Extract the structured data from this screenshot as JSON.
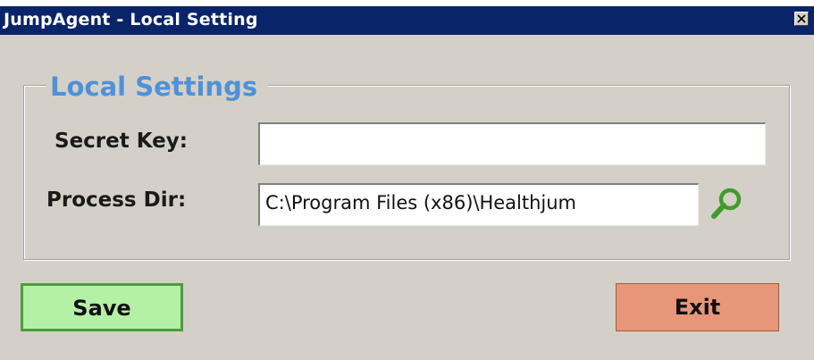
{
  "window": {
    "title": "JumpAgent - Local Setting"
  },
  "group": {
    "legend": "Local Settings"
  },
  "fields": {
    "secret_key": {
      "label": "Secret Key:",
      "value": ""
    },
    "process_dir": {
      "label": "Process Dir:",
      "value": "C:\\Program Files (x86)\\Healthjum"
    }
  },
  "buttons": {
    "save_label": "Save",
    "exit_label": "Exit"
  },
  "icons": {
    "close": "close-icon",
    "browse": "magnifier-icon"
  },
  "colors": {
    "titlebar": "#0a246a",
    "legend": "#4f91d9",
    "save": "#b4f0a5",
    "exit": "#e8967a",
    "browse_icon": "#3f9c2c"
  }
}
